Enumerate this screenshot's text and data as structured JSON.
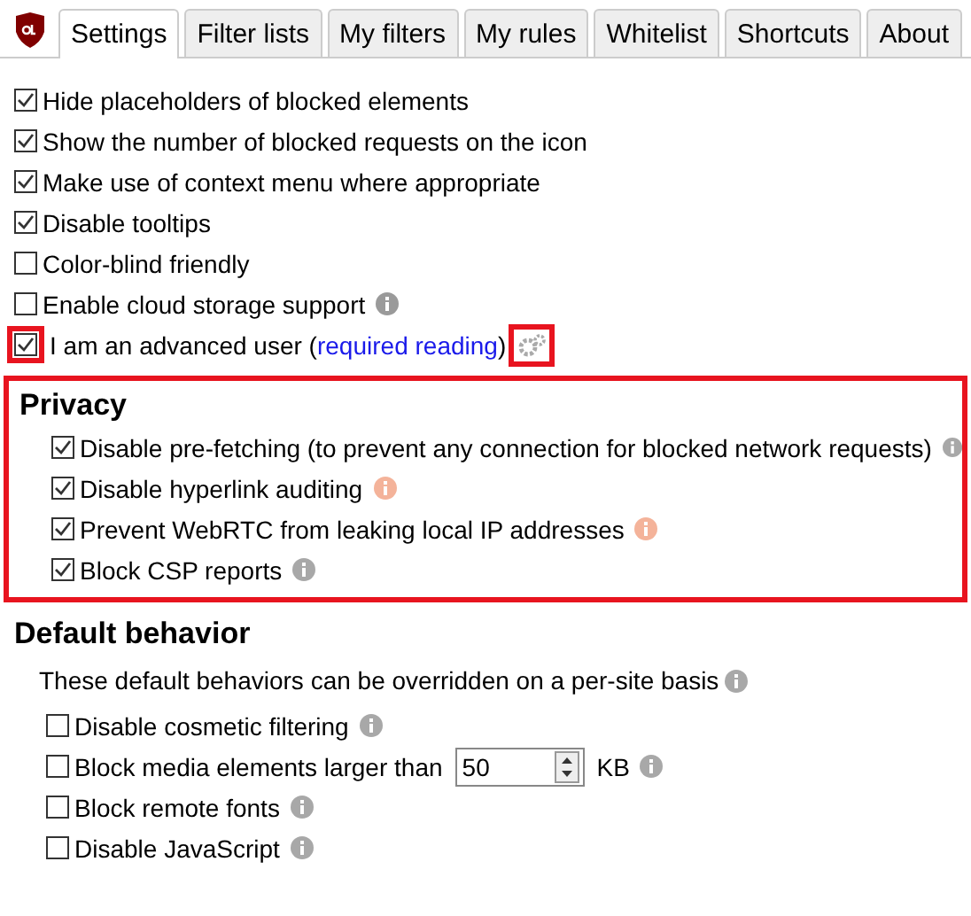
{
  "tabs": [
    {
      "label": "Settings",
      "selected": true
    },
    {
      "label": "Filter lists",
      "selected": false
    },
    {
      "label": "My filters",
      "selected": false
    },
    {
      "label": "My rules",
      "selected": false
    },
    {
      "label": "Whitelist",
      "selected": false
    },
    {
      "label": "Shortcuts",
      "selected": false
    },
    {
      "label": "About",
      "selected": false
    }
  ],
  "general": [
    {
      "label": "Hide placeholders of blocked elements",
      "checked": true
    },
    {
      "label": "Show the number of blocked requests on the icon",
      "checked": true
    },
    {
      "label": "Make use of context menu where appropriate",
      "checked": true
    },
    {
      "label": "Disable tooltips",
      "checked": true
    },
    {
      "label": "Color-blind friendly",
      "checked": false
    },
    {
      "label": "Enable cloud storage support",
      "checked": false,
      "color": "#9a9a9a"
    }
  ],
  "advanced": {
    "label": "I am an advanced user (",
    "link": "required reading",
    "close": ")",
    "checked": true,
    "highlighted": true,
    "gear_highlighted": true
  },
  "privacy": {
    "title": "Privacy",
    "highlighted": true,
    "items": [
      {
        "label": "Disable pre-fetching (to prevent any connection for blocked network requests)",
        "checked": true,
        "color": "#a8a8a8"
      },
      {
        "label": "Disable hyperlink auditing",
        "checked": true,
        "color": "#f4b39a"
      },
      {
        "label": "Prevent WebRTC from leaking local IP addresses",
        "checked": true,
        "color": "#f4b39a"
      },
      {
        "label": "Block CSP reports",
        "checked": true,
        "color": "#a8a8a8"
      }
    ]
  },
  "default_behavior": {
    "title": "Default behavior",
    "description": "These default behaviors can be overridden on a per-site basis",
    "items": [
      {
        "kind": "plain",
        "label": "Disable cosmetic filtering",
        "checked": false,
        "color": "#a8a8a8"
      },
      {
        "kind": "size",
        "label": "Block media elements larger than",
        "value": "50",
        "unit": "KB",
        "checked": false,
        "color": "#a8a8a8"
      },
      {
        "kind": "plain",
        "label": "Block remote fonts",
        "checked": false,
        "color": "#a8a8a8"
      },
      {
        "kind": "plain",
        "label": "Disable JavaScript",
        "checked": false,
        "color": "#a8a8a8"
      }
    ]
  }
}
